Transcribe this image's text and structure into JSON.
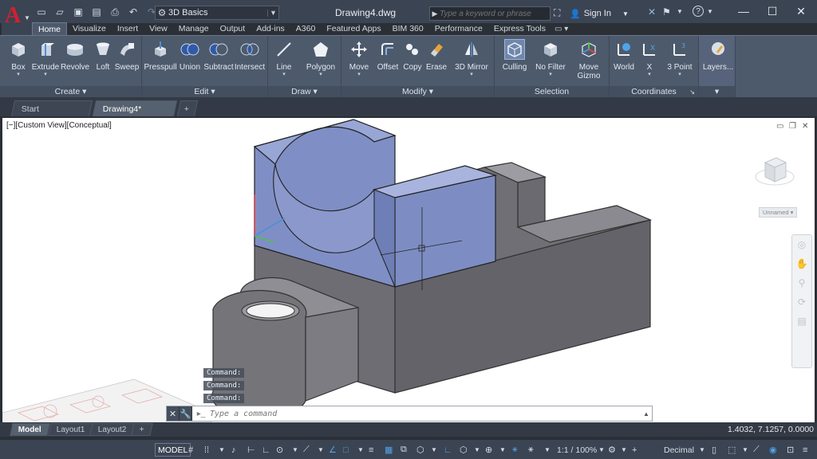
{
  "window": {
    "title": "Drawing4.dwg",
    "minimize": "—",
    "maximize": "☐",
    "close": "✕"
  },
  "app": {
    "logo_letter": "A"
  },
  "quick_access": {
    "workspace": "3D Basics",
    "icons": [
      "new-icon",
      "open-icon",
      "save-icon",
      "save-as-icon",
      "print-icon",
      "undo-icon",
      "redo-icon"
    ]
  },
  "search": {
    "placeholder": "Type a keyword or phrase"
  },
  "user": {
    "signin_label": "Sign In"
  },
  "ribbon_tabs": [
    "Home",
    "Visualize",
    "Insert",
    "View",
    "Manage",
    "Output",
    "Add-ins",
    "A360",
    "Featured Apps",
    "BIM 360",
    "Performance",
    "Express Tools"
  ],
  "ribbon": {
    "panels": {
      "create": "Create ▾",
      "edit": "Edit ▾",
      "draw": "Draw ▾",
      "modify": "Modify ▾",
      "selection": "Selection",
      "coordinates": "Coordinates",
      "coordinates_launcher": "↘",
      "layers_more": "▾"
    },
    "tools": {
      "box": "Box",
      "extrude": "Extrude",
      "revolve": "Revolve",
      "loft": "Loft",
      "sweep": "Sweep",
      "presspull": "Presspull",
      "union": "Union",
      "subtract": "Subtract",
      "intersect": "Intersect",
      "line": "Line",
      "polygon": "Polygon",
      "move": "Move",
      "offset": "Offset",
      "copy": "Copy",
      "erase": "Erase",
      "mirror3d": "3D Mirror",
      "culling": "Culling",
      "nofilter": "No Filter",
      "movegizmo": "Move Gizmo",
      "world": "World",
      "x": "X",
      "threepoint": "3 Point",
      "layers": "Layers..."
    }
  },
  "doc_tabs": {
    "start": "Start",
    "drawing": "Drawing4*",
    "new_tab": "+"
  },
  "viewport": {
    "label": "[−][Custom View][Conceptual]",
    "viewcube_label": "Unnamed ▾",
    "command_history": [
      "Command:",
      "Command:",
      "Command:"
    ]
  },
  "command_line": {
    "placeholder": "Type a command"
  },
  "layout_tabs": {
    "model": "Model",
    "layout1": "Layout1",
    "layout2": "Layout2",
    "add": "+"
  },
  "coordinates_readout": "1.4032, 7.1257, 0.0000",
  "status_bar": {
    "model": "MODEL",
    "scale": "1:1 / 100%",
    "units": "Decimal"
  },
  "colors": {
    "accent": "#4fa3e8",
    "solid_blue": "#7f8fc5",
    "solid_gray": "#6c6c72",
    "logo_red": "#d3202f"
  }
}
